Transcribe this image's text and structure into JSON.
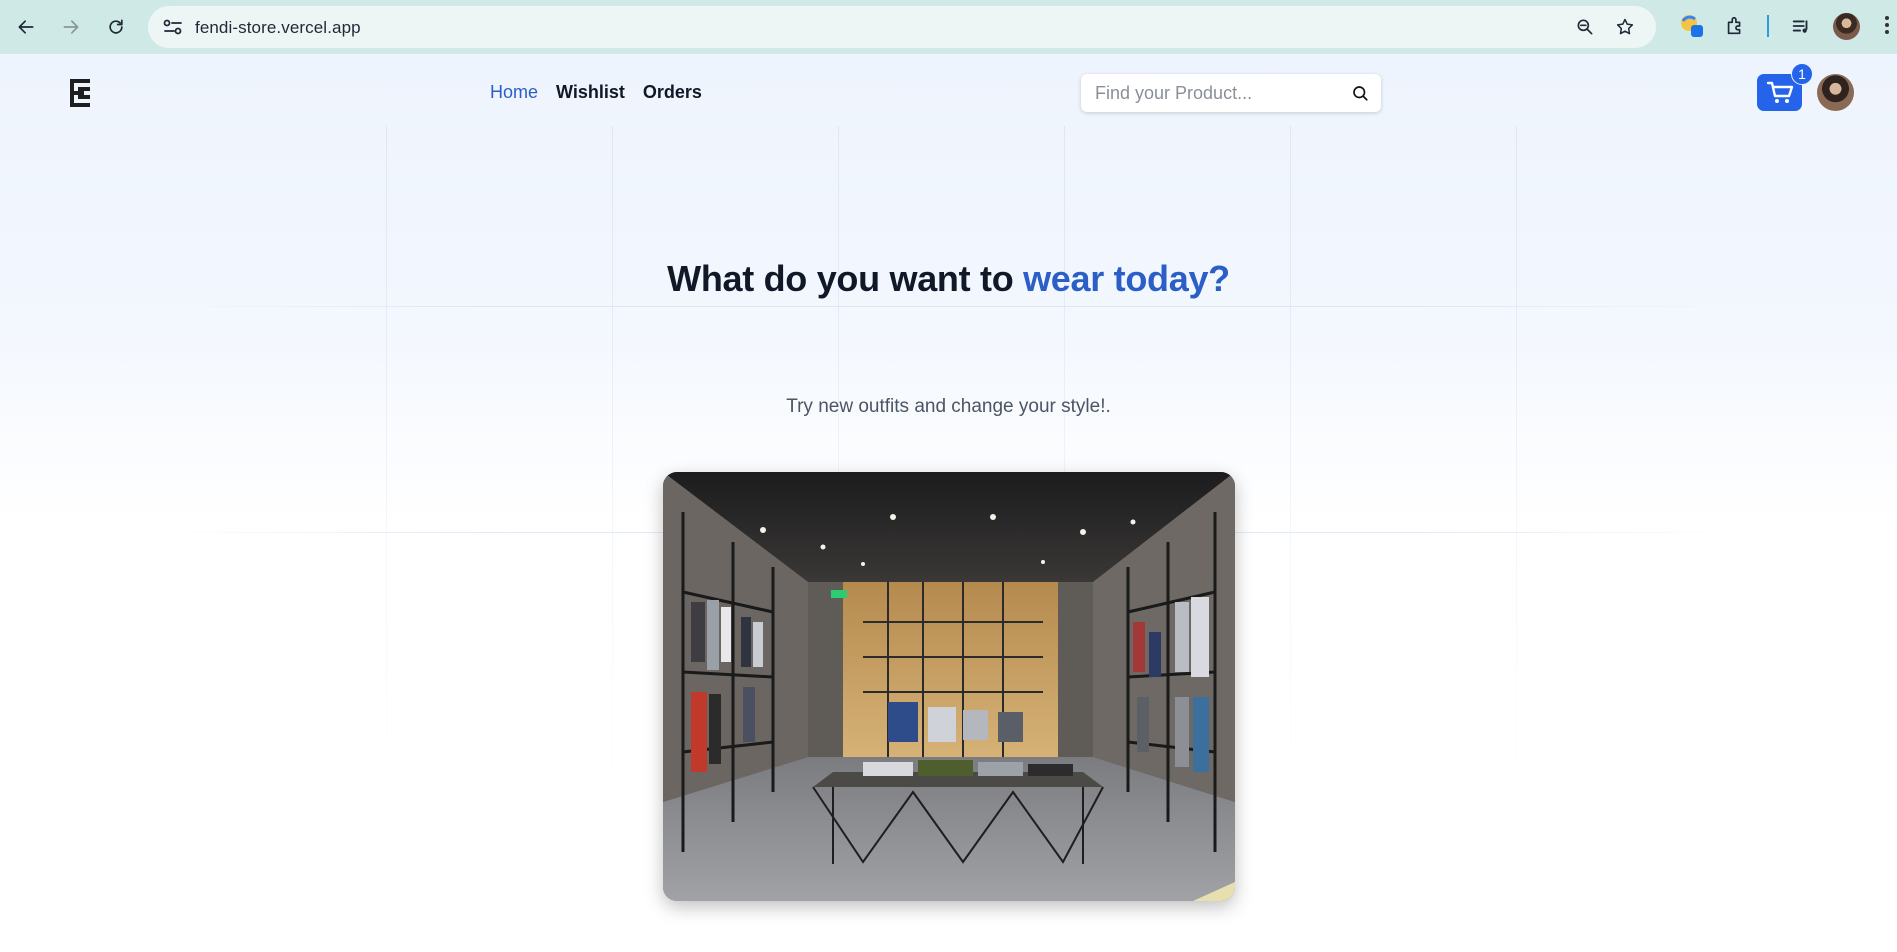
{
  "browser": {
    "url": "fendi-store.vercel.app",
    "back_icon": "arrow-left-icon",
    "forward_icon": "arrow-right-icon",
    "reload_icon": "reload-icon"
  },
  "header": {
    "nav": [
      {
        "label": "Home",
        "active": true
      },
      {
        "label": "Wishlist",
        "active": false
      },
      {
        "label": "Orders",
        "active": false
      }
    ],
    "search": {
      "placeholder": "Find your Product..."
    },
    "cart": {
      "count": "1"
    },
    "colors": {
      "accent": "#2b5ec6",
      "cart": "#2563eb"
    }
  },
  "hero": {
    "title_main": "What do you want to ",
    "title_accent": "wear today?",
    "subtitle": "Try new outfits and change your style!."
  }
}
